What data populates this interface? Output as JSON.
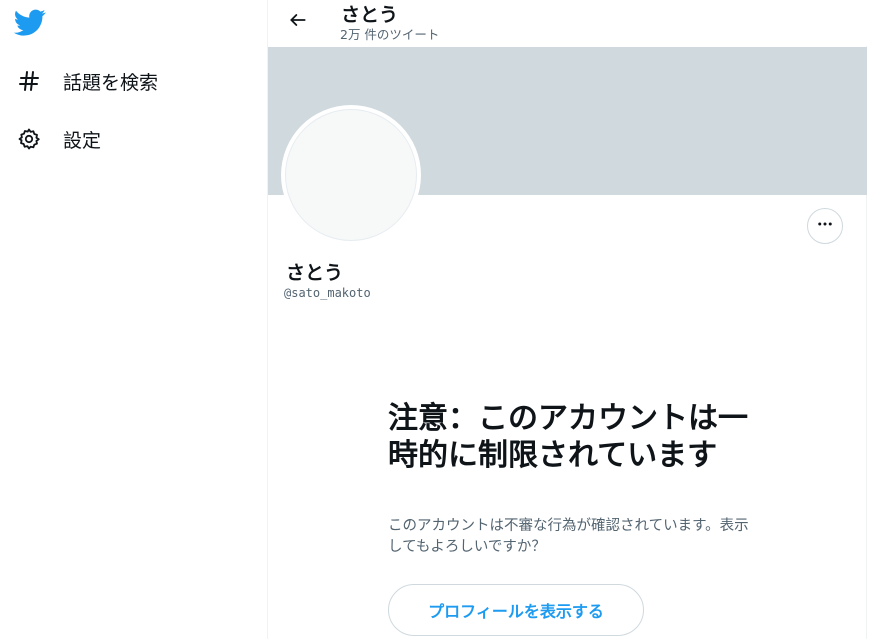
{
  "sidebar": {
    "logo_icon": "twitter-bird-icon",
    "items": [
      {
        "icon": "hashtag-icon",
        "label": "話題を検索"
      },
      {
        "icon": "gear-icon",
        "label": "設定"
      }
    ]
  },
  "header": {
    "back_icon": "arrow-left-icon",
    "title": "さとう",
    "tweet_count": "2万 件のツイート"
  },
  "profile": {
    "display_name": "さとう",
    "handle": "@sato_makoto",
    "more_icon": "more-horizontal-icon"
  },
  "warning": {
    "title": "注意：このアカウントは一時的に制限されています",
    "description": "このアカウントは不審な行為が確認されています。表示してもよろしいですか？",
    "button_label": "プロフィールを表示する"
  },
  "colors": {
    "brand": "#1d9bf0",
    "banner": "#cfd9de",
    "text_primary": "#0f1419",
    "text_secondary": "#536471"
  }
}
